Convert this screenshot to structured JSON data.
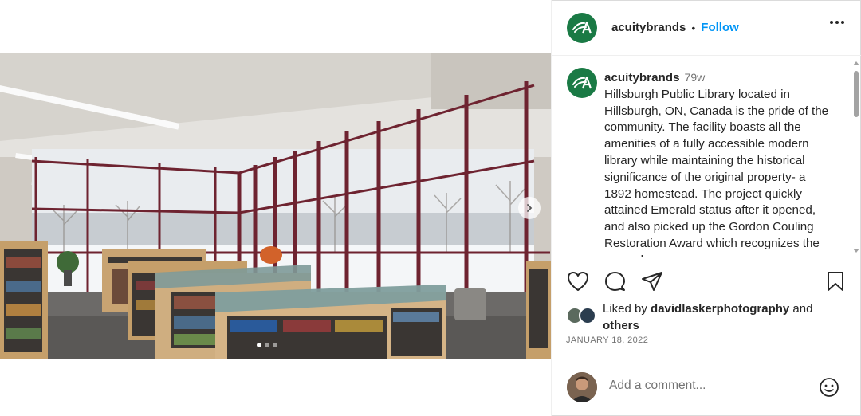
{
  "post": {
    "username": "acuitybrands",
    "separator": "•",
    "follow_label": "Follow",
    "time_ago": "79w",
    "caption": "Hillsburgh Public Library located in Hillsburgh, ON, Canada is the pride of the community. The facility boasts all the amenities of a fully accessible modern library while maintaining the historical significance of the original property- a 1892 homestead. The project quickly attained Emerald status after it opened, and also picked up the Gordon Couling Restoration Award which recognizes the exemplary",
    "likes": {
      "prefix": "Liked by ",
      "user": "davidlaskerphotography",
      "middle": " and ",
      "others": "others"
    },
    "date": "JANUARY 18, 2022"
  },
  "carousel": {
    "slide_count": 3,
    "active_index": 0
  },
  "comment": {
    "placeholder": "Add a comment..."
  },
  "icons": {
    "avatar_logo": "acuity-logo-icon",
    "more": "more-options-icon",
    "like": "heart-icon",
    "comment": "comment-icon",
    "share": "share-icon",
    "save": "bookmark-icon",
    "emoji": "emoji-icon",
    "next": "chevron-right-icon"
  },
  "colors": {
    "brand_green": "#1a7a45",
    "link_blue": "#0095f6",
    "text": "#262626",
    "muted": "#737373",
    "window_frame": "#6e2330"
  }
}
